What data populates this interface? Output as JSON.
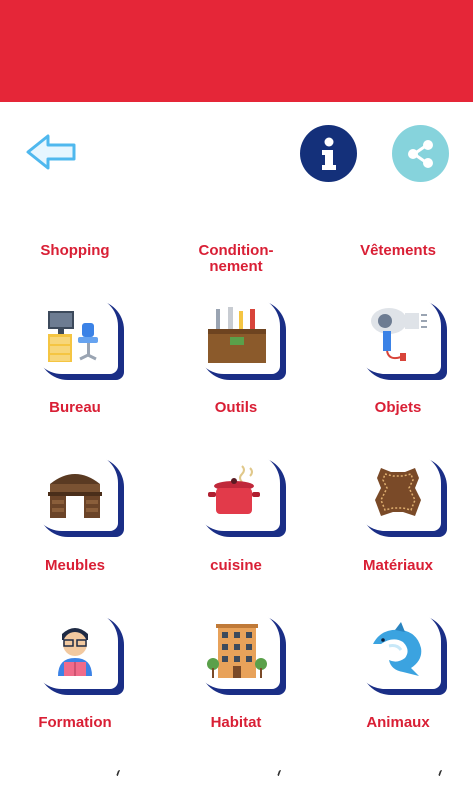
{
  "header": {
    "bar_color": "#e52638"
  },
  "toolbar": {
    "back_icon": "back-arrow-icon",
    "info_icon": "info-icon",
    "share_icon": "share-icon",
    "info_glyph": "i"
  },
  "top_labels": [
    "Shopping",
    "Condition-\nnement",
    "Vêtements"
  ],
  "categories": [
    {
      "label": "Bureau",
      "icon": "office-desk-icon"
    },
    {
      "label": "Outils",
      "icon": "toolbox-icon"
    },
    {
      "label": "Objets",
      "icon": "hair-dryer-icon"
    },
    {
      "label": "Meubles",
      "icon": "desk-furniture-icon"
    },
    {
      "label": "cuisine",
      "icon": "cooking-pot-icon"
    },
    {
      "label": "Matériaux",
      "icon": "leather-icon"
    },
    {
      "label": "Formation",
      "icon": "student-icon"
    },
    {
      "label": "Habitat",
      "icon": "building-icon"
    },
    {
      "label": "Animaux",
      "icon": "dolphin-icon"
    }
  ],
  "colors": {
    "accent_red": "#d91f35",
    "navy": "#14307a",
    "share_teal": "#86d3dc",
    "back_blue": "#4fb8ee"
  }
}
